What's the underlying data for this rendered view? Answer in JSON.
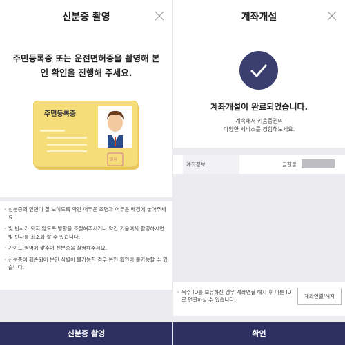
{
  "left_panel": {
    "title": "신분증 촬영",
    "heading_line1": "주민등록증 또는 운전면허증을 촬영해 본",
    "heading_line2": "인 확인을 진행해 주세요.",
    "id_card": {
      "label": "주민등록증",
      "seal_text": "발급"
    },
    "notes": [
      "신분증의 앞면이 잘 보이도록 약간 어두운 조명과 어두운 배경에 놓아주세요.",
      "빛 반사가 되지 않도록 방향을 조절해주시거나 약간 기울여서 촬영하시면 빛 반사를 최소화 할 수 있습니다.",
      "가이드 영역에 맞추어 신분증을 촬영해주세요.",
      "신분증이 훼손되어 본인 식별이 불가능한 경우 본인 확인이 불가능할 수 있습니다."
    ],
    "footer_label": "신분증 촬영"
  },
  "right_panel": {
    "title": "계좌개설",
    "done_title": "계좌개설이 완료되었습니다.",
    "done_sub_line1": "계속해서 키움증권의",
    "done_sub_line2": "다양한 서비스를 경험해보세요.",
    "account": {
      "label": "계좌정보",
      "holder_name": "금현물"
    },
    "bottom_note": "복수 ID를 보유하신 경우 계좌연결 해지 후 다른 ID로 연결하실 수 있습니다.",
    "relink_button": "계좌연결/해지",
    "footer_label": "확인"
  },
  "colors": {
    "accent_navy": "#2d3061",
    "check_circle": "#3b3f70",
    "card_yellow": "#f5de7a"
  },
  "icons": {
    "close": "close-icon",
    "check": "check-icon"
  }
}
